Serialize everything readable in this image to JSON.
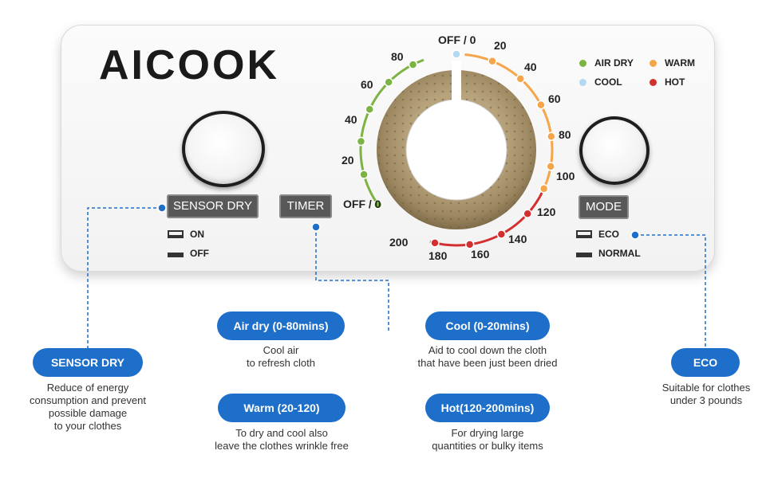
{
  "brand": "AICOOK",
  "controls": {
    "sensor_dry_label": "SENSOR DRY",
    "timer_label": "TIMER",
    "mode_label": "MODE",
    "sensor_on": "ON",
    "sensor_off": "OFF",
    "mode_eco": "ECO",
    "mode_normal": "NORMAL"
  },
  "legend": [
    {
      "label": "AIR DRY",
      "color": "#7cb342"
    },
    {
      "label": "WARM",
      "color": "#f5a54a"
    },
    {
      "label": "COOL",
      "color": "#b3d9f0"
    },
    {
      "label": "HOT",
      "color": "#d32f2f"
    }
  ],
  "dial": {
    "top_off": "OFF / 0",
    "left_off": "OFF / 0",
    "left_scale": [
      "20",
      "40",
      "60",
      "80"
    ],
    "right_scale": [
      "20",
      "40",
      "60",
      "80",
      "100",
      "120",
      "140",
      "160",
      "180",
      "200"
    ]
  },
  "callouts": {
    "sensor_dry": {
      "title": "SENSOR DRY",
      "lines": [
        "Reduce of energy",
        "consumption and prevent",
        "possible damage",
        "to your clothes"
      ]
    },
    "air_dry": {
      "title": "Air dry (0-80mins)",
      "lines": [
        "Cool air",
        "to refresh cloth"
      ]
    },
    "warm": {
      "title": "Warm (20-120)",
      "lines": [
        "To dry and cool also",
        "leave the clothes wrinkle free"
      ]
    },
    "cool": {
      "title": "Cool (0-20mins)",
      "lines": [
        "Aid to cool down the cloth",
        "that have been just been dried"
      ]
    },
    "hot": {
      "title": "Hot(120-200mins)",
      "lines": [
        "For drying large",
        "quantities or bulky items"
      ]
    },
    "eco": {
      "title": "ECO",
      "lines": [
        "Suitable for clothes",
        "under 3 pounds"
      ]
    }
  }
}
